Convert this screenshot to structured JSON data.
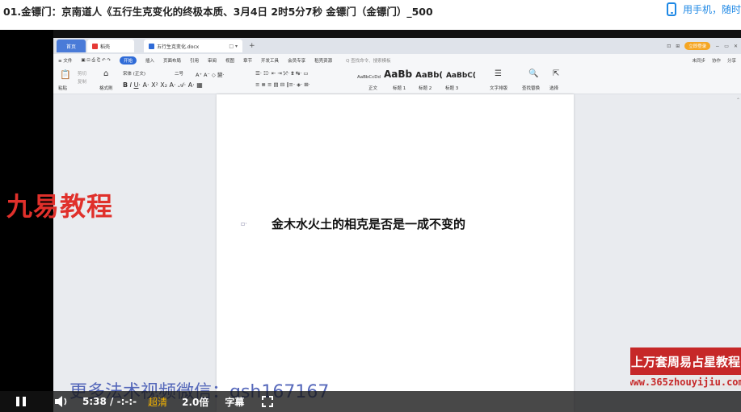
{
  "page": {
    "title": "01.金镖门：京南道人《五行生克变化的终极本质、3月4日 2时5分7秒 金镖门（金镖门）_500",
    "mobile_link": "用手机，随时"
  },
  "wps": {
    "tabs": [
      {
        "label": "首页"
      },
      {
        "label": "稻壳"
      },
      {
        "label": "五行生克变化.docx"
      }
    ],
    "login_label": "立即登录",
    "menu_file": "≡ 文件",
    "menu_items": [
      "开始",
      "插入",
      "页面布局",
      "引用",
      "审阅",
      "视图",
      "章节",
      "开发工具",
      "会员专享",
      "稻壳资源"
    ],
    "search_placeholder": "Q 查找命令、搜索模板",
    "menu_right": [
      "未同步",
      "协作",
      "分享"
    ],
    "ribbon": {
      "paste": "粘贴",
      "cut": "剪切",
      "copy": "复制",
      "format_painter": "格式刷",
      "font_name": "宋体 (正文)",
      "font_size": "二号",
      "style_labels": [
        "正文",
        "标题 1",
        "标题 2",
        "标题 3"
      ],
      "style_previews": [
        "AaBbCcDd",
        "AaBb",
        "AaBb(",
        "AaBbC("
      ],
      "text_layout": "文字排版",
      "find_replace": "查找替换",
      "select": "选择"
    },
    "document": {
      "heading": "金木水火土的相克是否是一成不变的"
    }
  },
  "watermarks": {
    "left": "九易教程",
    "right_top": "上万套周易占星教程",
    "right_bottom": "www.365zhouyijiu.com",
    "bottom": "更多法术视频微信：qsh167167"
  },
  "controls": {
    "time": "5:38 / -:-:-",
    "quality": "超清",
    "speed": "2.0倍",
    "subtitles": "字幕"
  },
  "colors": {
    "accent_blue": "#1e88e5",
    "wps_blue": "#2f6bd7",
    "watermark_red": "#e0302b",
    "quality_gold": "#f5b400"
  }
}
